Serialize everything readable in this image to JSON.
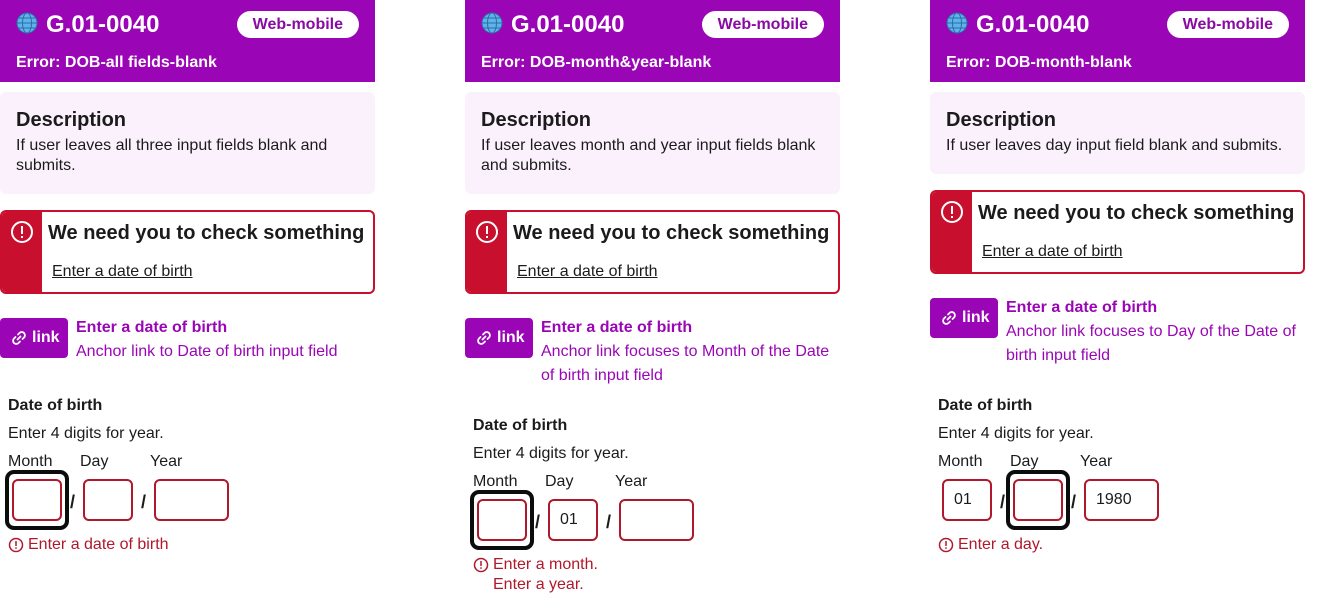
{
  "colors": {
    "header": "#9a06b6",
    "error": "#c8102e",
    "error_text": "#b0182b",
    "desc_bg": "#fbf1fd"
  },
  "common": {
    "code": "G.01-0040",
    "platform": "Web-mobile",
    "description_heading": "Description",
    "summary_heading": "We need you to check something",
    "summary_link": "Enter a date of birth",
    "link_button": "link",
    "anchor_title": "Enter a date of birth",
    "dob_label": "Date of birth",
    "dob_hint": "Enter 4 digits for year.",
    "month_label": "Month",
    "day_label": "Day",
    "year_label": "Year",
    "slash": "/"
  },
  "cards": [
    {
      "error_title": "Error: DOB-all fields-blank",
      "description": "If user leaves all three input fields blank and submits.",
      "anchor_text": "Anchor link to Date of birth input field",
      "month_value": "",
      "day_value": "",
      "year_value": "",
      "errors": [
        "Enter a date of birth"
      ]
    },
    {
      "error_title": "Error: DOB-month&year-blank",
      "description": "If user leaves month and year input fields blank and submits.",
      "anchor_text": "Anchor link focuses to Month of the Date of birth input field",
      "month_value": "",
      "day_value": "01",
      "year_value": "",
      "errors": [
        "Enter a month.",
        "Enter a year."
      ]
    },
    {
      "error_title": "Error: DOB-month-blank",
      "description": "If user leaves day input field blank and submits.",
      "anchor_text": "Anchor link focuses to Day of the Date of birth input field",
      "month_value": "01",
      "day_value": "",
      "year_value": "1980",
      "errors": [
        "Enter a day."
      ]
    }
  ]
}
